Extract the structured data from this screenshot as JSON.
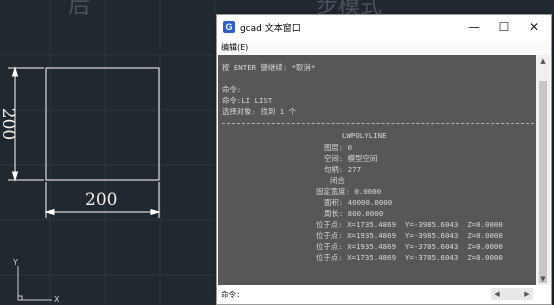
{
  "drawing": {
    "bg_text_left": "后",
    "bg_text_right": "步模式",
    "dim_horizontal": "200",
    "dim_vertical": "200",
    "ucs_y_label": "Y",
    "ucs_x_label": "X"
  },
  "window": {
    "icon_letter": "G",
    "title": "gcad 文本窗口",
    "minimize": "—",
    "maximize": "☐",
    "close": "✕",
    "menu_edit": "编辑(E)"
  },
  "console": {
    "lines": [
      "按 ENTER 键继续: *取消*",
      "命令:",
      "命令:LI LIST",
      "选择对象: 找到 1 个",
      "LWPOLYLINE",
      "图层: 0",
      "空间: 模型空间",
      "句柄: 277",
      "闭合",
      "固定宽度: 0.0000",
      "面积: 40000.0000",
      "周长: 800.0000",
      "位于点: X=1735.4869  Y=-3985.6043  Z=0.0000",
      "位于点: X=1935.4869  Y=-3985.6043  Z=0.0000",
      "位于点: X=1935.4869  Y=-3785.6043  Z=0.0000",
      "位于点: X=1735.4869  Y=-3785.6043  Z=0.0000"
    ],
    "prompt": "命令:"
  },
  "colors": {
    "drawing_bg": "#212830",
    "console_bg": "#575757",
    "console_text": "#d8d8d8",
    "app_icon": "#2f5fc7"
  }
}
